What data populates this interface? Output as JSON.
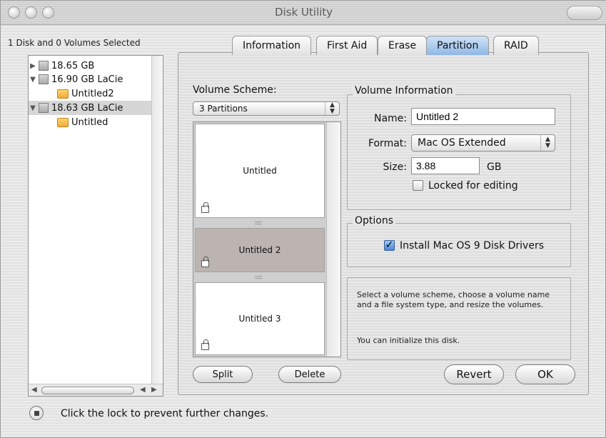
{
  "window": {
    "title": "Disk Utility"
  },
  "sidebar": {
    "status": "1 Disk and 0 Volumes Selected",
    "items": [
      {
        "label": "18.65 GB",
        "kind": "disk",
        "expanded": false,
        "selected": false
      },
      {
        "label": "16.90 GB LaCie",
        "kind": "disk",
        "expanded": true,
        "selected": false
      },
      {
        "label": "Untitled2",
        "kind": "volume",
        "selected": false
      },
      {
        "label": "18.63 GB LaCie",
        "kind": "disk",
        "expanded": true,
        "selected": true
      },
      {
        "label": "Untitled",
        "kind": "volume",
        "selected": false
      }
    ]
  },
  "tabs": [
    {
      "label": "Information",
      "active": false
    },
    {
      "label": "First Aid",
      "active": false
    },
    {
      "label": "Erase",
      "active": false
    },
    {
      "label": "Partition",
      "active": true
    },
    {
      "label": "RAID",
      "active": false
    }
  ],
  "partition": {
    "volume_scheme_label": "Volume Scheme:",
    "volume_scheme_value": "3 Partitions",
    "partitions": [
      {
        "name": "Untitled",
        "selected": false
      },
      {
        "name": "Untitled 2",
        "selected": true
      },
      {
        "name": "Untitled 3",
        "selected": false
      }
    ],
    "volume_information": {
      "group_label": "Volume Information",
      "name_label": "Name:",
      "name_value": "Untitled 2",
      "format_label": "Format:",
      "format_value": "Mac OS Extended",
      "size_label": "Size:",
      "size_value": "3.88",
      "size_unit": "GB",
      "locked_label": "Locked for editing",
      "locked_checked": false
    },
    "options": {
      "group_label": "Options",
      "install_drivers_label": "Install Mac OS 9 Disk Drivers",
      "install_drivers_checked": true
    },
    "help_text": "Select a volume scheme, choose a volume name and a file system type, and resize the volumes.",
    "help_text_2": "You can initialize this disk.",
    "buttons": {
      "split": "Split",
      "delete": "Delete",
      "revert": "Revert",
      "ok": "OK"
    }
  },
  "footer": {
    "lock_text": "Click the lock to prevent further changes."
  },
  "colors": {
    "active_tab": "#8fb8e6",
    "selected_partition": "#bcb4b1",
    "checkbox_checked": "#4c86d3"
  }
}
